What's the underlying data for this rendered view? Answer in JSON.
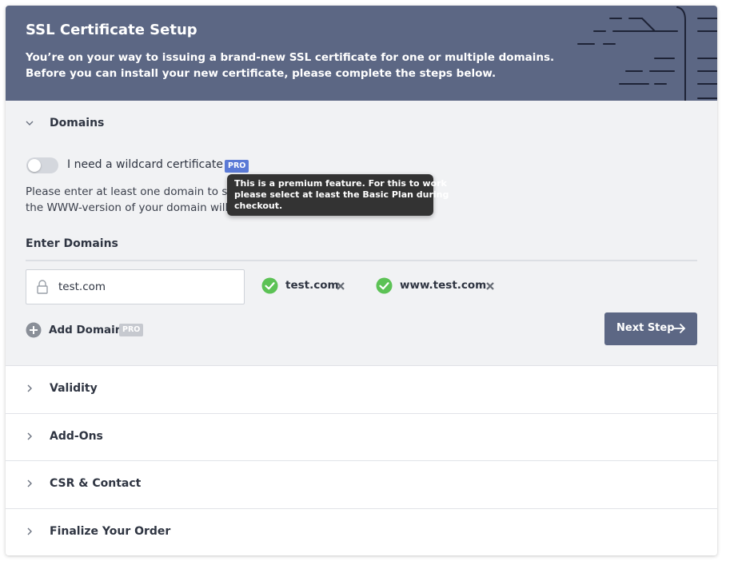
{
  "header": {
    "title": "SSL Certificate Setup",
    "description_lines": [
      "You’re on your way to issuing a brand-new SSL certificate for one or multiple domains.",
      "Before you can install your new certificate, please complete the steps below."
    ]
  },
  "domains_section": {
    "title": "Domains",
    "wildcard": {
      "label": "I need a wildcard certificate",
      "enabled": false,
      "badge": "PRO"
    },
    "info_lines": [
      "Please enter at least one domain to sec",
      "the WWW-version of your domain will a"
    ],
    "tooltip_lines": [
      "This is a premium feature. For this to work",
      "please select at least the Basic Plan during",
      "checkout."
    ],
    "enter_label": "Enter Domains",
    "input_value": "test.com",
    "domains": [
      {
        "name": "test.com"
      },
      {
        "name": "www.test.com"
      }
    ],
    "add_domain_label": "Add Domain",
    "add_domain_badge": "PRO",
    "next_button_label": "Next Step"
  },
  "sections": [
    {
      "title": "Validity"
    },
    {
      "title": "Add-Ons"
    },
    {
      "title": "CSR & Contact"
    },
    {
      "title": "Finalize Your Order"
    }
  ],
  "icons": {
    "chevron_open": "chevron-down-icon",
    "chevron_closed": "chevron-right-icon",
    "lock": "lock-icon",
    "check": "check-circle-icon",
    "remove": "close-icon",
    "add": "plus-circle-icon",
    "next": "arrow-right-icon"
  },
  "colors": {
    "header_bg": "#5c6784",
    "section_bg": "#f1f2f4",
    "pro_badge": "#5b7ad6",
    "pro_badge_disabled": "#c6c9cf",
    "check_green": "#5cc255",
    "button_bg": "#5c6784",
    "tooltip_bg": "#333333"
  }
}
